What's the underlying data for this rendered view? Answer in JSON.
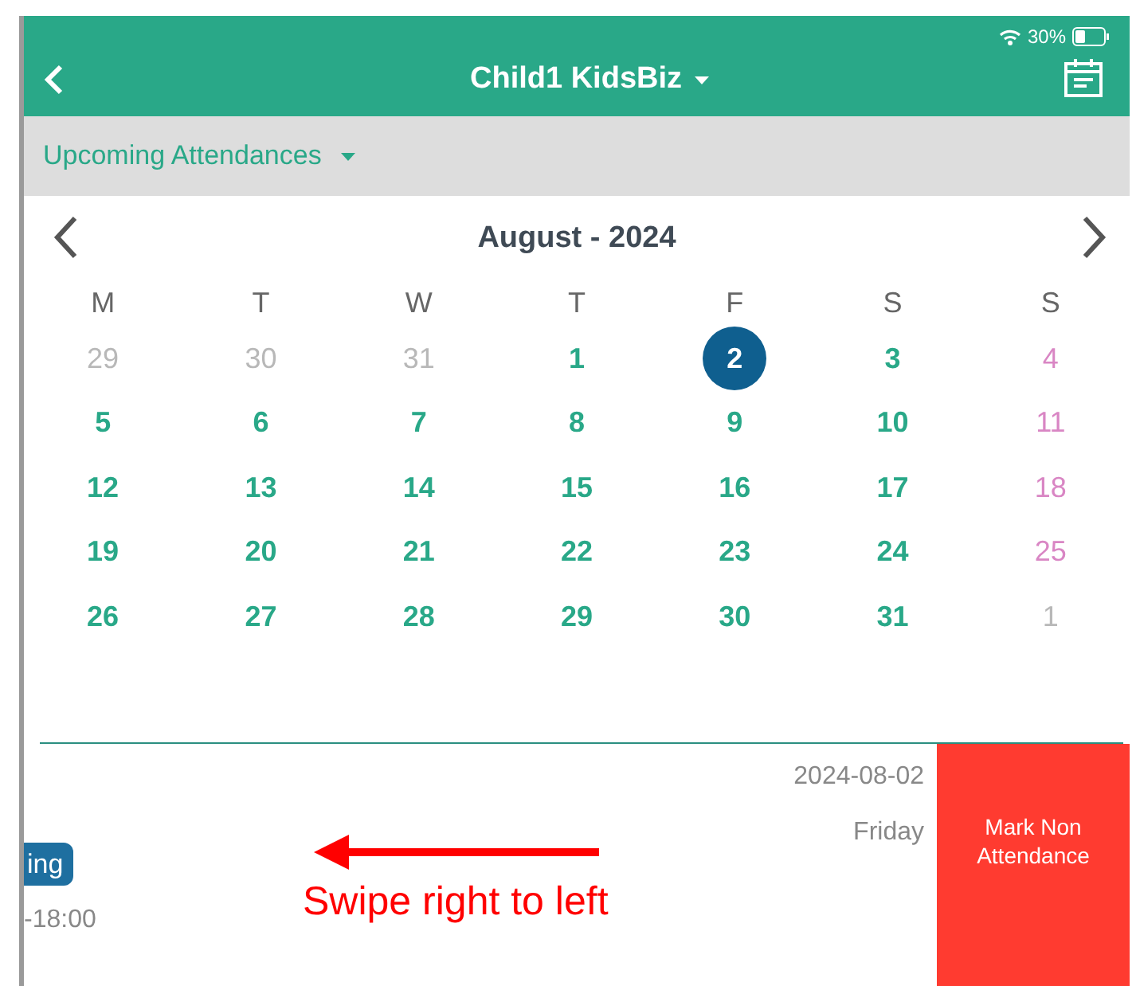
{
  "status_bar": {
    "battery": "30%"
  },
  "header": {
    "title": "Child1 KidsBiz"
  },
  "filter": {
    "label": "Upcoming Attendances"
  },
  "calendar": {
    "title": "August - 2024",
    "weekdays": [
      "M",
      "T",
      "W",
      "T",
      "F",
      "S",
      "S"
    ],
    "days": [
      {
        "label": "29",
        "kind": "other",
        "selected": false
      },
      {
        "label": "30",
        "kind": "other",
        "selected": false
      },
      {
        "label": "31",
        "kind": "other",
        "selected": false
      },
      {
        "label": "1",
        "kind": "weekday",
        "selected": false
      },
      {
        "label": "2",
        "kind": "weekday",
        "selected": true
      },
      {
        "label": "3",
        "kind": "weekday",
        "selected": false
      },
      {
        "label": "4",
        "kind": "weekend",
        "selected": false
      },
      {
        "label": "5",
        "kind": "weekday",
        "selected": false
      },
      {
        "label": "6",
        "kind": "weekday",
        "selected": false
      },
      {
        "label": "7",
        "kind": "weekday",
        "selected": false
      },
      {
        "label": "8",
        "kind": "weekday",
        "selected": false
      },
      {
        "label": "9",
        "kind": "weekday",
        "selected": false
      },
      {
        "label": "10",
        "kind": "weekday",
        "selected": false
      },
      {
        "label": "11",
        "kind": "weekend",
        "selected": false
      },
      {
        "label": "12",
        "kind": "weekday",
        "selected": false
      },
      {
        "label": "13",
        "kind": "weekday",
        "selected": false
      },
      {
        "label": "14",
        "kind": "weekday",
        "selected": false
      },
      {
        "label": "15",
        "kind": "weekday",
        "selected": false
      },
      {
        "label": "16",
        "kind": "weekday",
        "selected": false
      },
      {
        "label": "17",
        "kind": "weekday",
        "selected": false
      },
      {
        "label": "18",
        "kind": "weekend",
        "selected": false
      },
      {
        "label": "19",
        "kind": "weekday",
        "selected": false
      },
      {
        "label": "20",
        "kind": "weekday",
        "selected": false
      },
      {
        "label": "21",
        "kind": "weekday",
        "selected": false
      },
      {
        "label": "22",
        "kind": "weekday",
        "selected": false
      },
      {
        "label": "23",
        "kind": "weekday",
        "selected": false
      },
      {
        "label": "24",
        "kind": "weekday",
        "selected": false
      },
      {
        "label": "25",
        "kind": "weekend",
        "selected": false
      },
      {
        "label": "26",
        "kind": "weekday",
        "selected": false
      },
      {
        "label": "27",
        "kind": "weekday",
        "selected": false
      },
      {
        "label": "28",
        "kind": "weekday",
        "selected": false
      },
      {
        "label": "29",
        "kind": "weekday",
        "selected": false
      },
      {
        "label": "30",
        "kind": "weekday",
        "selected": false
      },
      {
        "label": "31",
        "kind": "weekday",
        "selected": false
      },
      {
        "label": "1",
        "kind": "other",
        "selected": false
      }
    ]
  },
  "attendance": {
    "badge": "ing",
    "time": "-18:00",
    "date": "2024-08-02",
    "weekday": "Friday",
    "action": "Mark Non Attendance"
  },
  "annotation": {
    "text": "Swipe right to left"
  }
}
